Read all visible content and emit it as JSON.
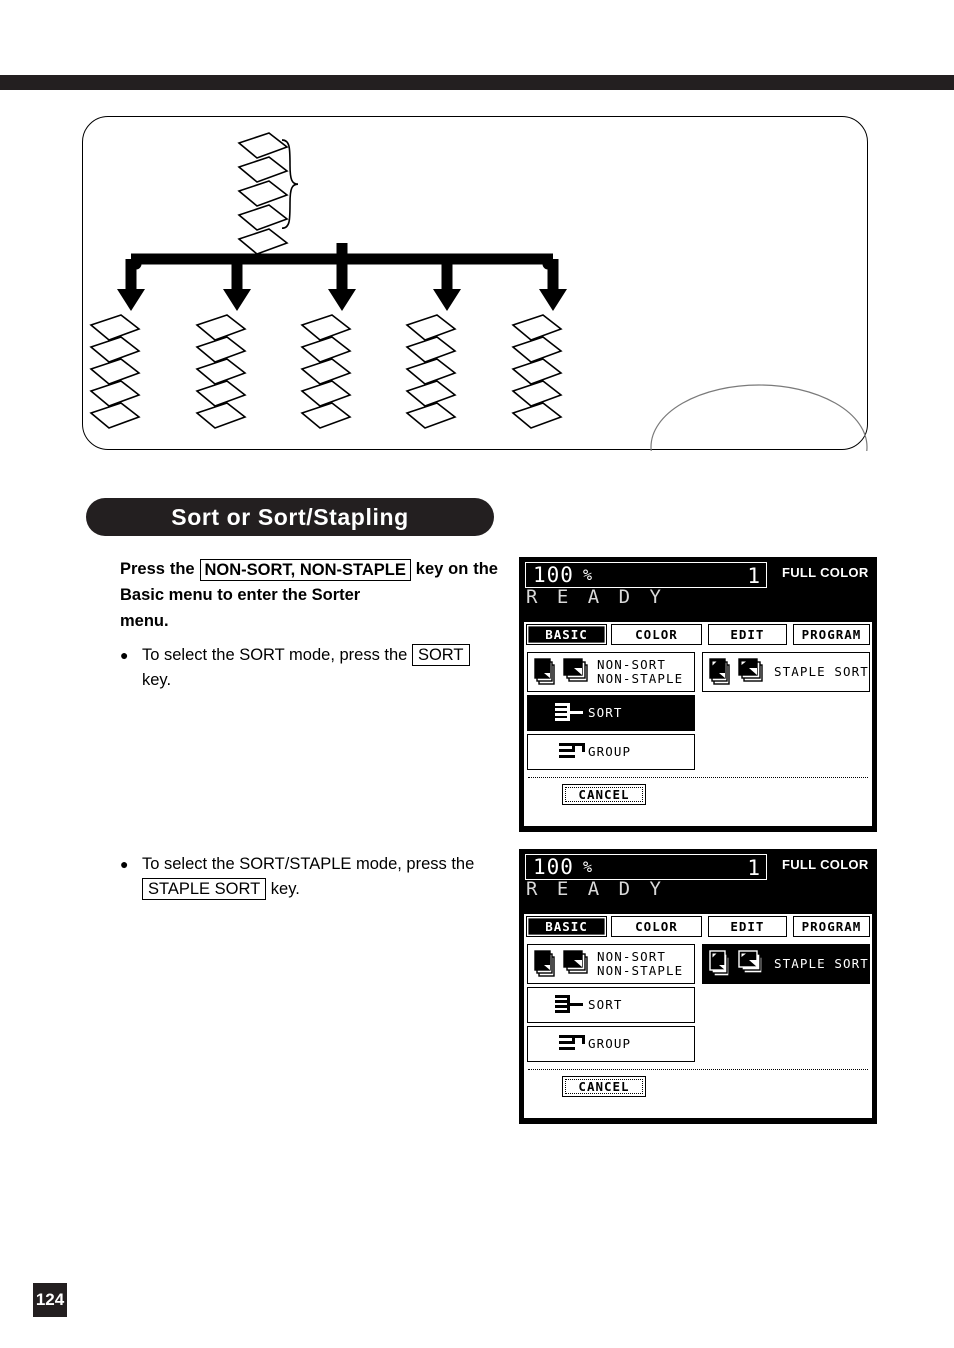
{
  "page": {
    "number": "124",
    "section_title": "Sort or Sort/Stapling"
  },
  "illustration": {
    "name": "sort-distribution-diagram",
    "source_stack_sheets": 5,
    "output_stacks": 5,
    "sheets_per_output_stack": 5,
    "arrows": 5
  },
  "instructions": {
    "main_before": "Press the",
    "main_key": "NON-SORT, NON-STAPLE",
    "main_after": "key on the Basic menu to enter the Sorter",
    "main_lastline": "menu.",
    "bullet_dot": "●",
    "bullet1_before": "To select the SORT mode, press the",
    "bullet1_key": "SORT",
    "bullet1_after": "key.",
    "bullet2_before": "To select the SORT/STAPLE mode, press the",
    "bullet2_key": "STAPLE SORT",
    "bullet2_after": "key."
  },
  "lcd_common": {
    "zoom_ratio": "100",
    "percent_sign": "%",
    "copy_count": "1",
    "color_mode": "FULL COLOR",
    "status": "R E A D Y",
    "tabs": [
      {
        "label": "BASIC",
        "selected": true
      },
      {
        "label": "COLOR",
        "selected": false
      },
      {
        "label": "EDIT",
        "selected": false
      },
      {
        "label": "PROGRAM",
        "selected": false
      }
    ],
    "cancel_label": "CANCEL",
    "buttons": {
      "non_sort": "NON-SORT\nNON-STAPLE",
      "sort": "SORT",
      "group": "GROUP",
      "staple_sort": "STAPLE SORT"
    }
  },
  "lcd_panel_1": {
    "caption_ref": "sort-mode-selected",
    "selected_button": "SORT"
  },
  "lcd_panel_2": {
    "caption_ref": "staple-sort-mode-selected",
    "selected_button": "STAPLE SORT"
  },
  "colors": {
    "ink_black": "#231f20",
    "paper_white": "#ffffff",
    "lcd_text": "#d9d9d9"
  }
}
